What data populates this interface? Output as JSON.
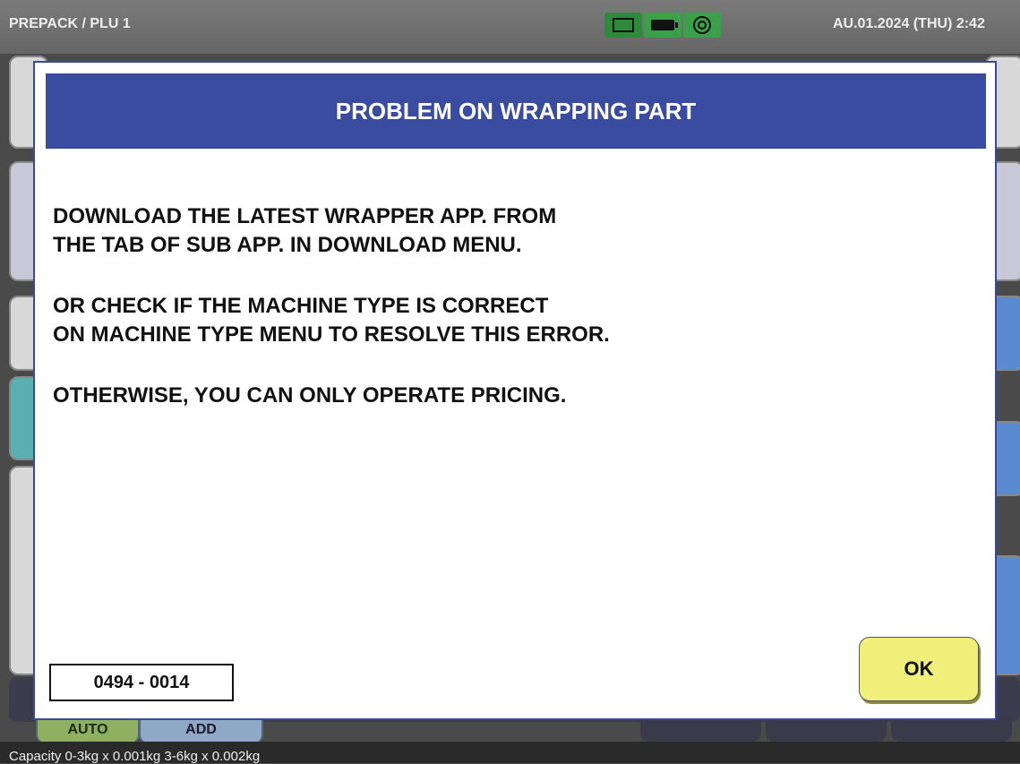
{
  "topbar": {
    "title": "PREPACK / PLU 1",
    "datetime": "AU.01.2024 (THU)  2:42",
    "icons": [
      "screen-icon",
      "battery-icon",
      "spinner-icon"
    ]
  },
  "dialog": {
    "title": "PROBLEM ON WRAPPING PART",
    "lines": [
      "DOWNLOAD THE LATEST WRAPPER APP. FROM",
      "THE TAB OF SUB APP. IN DOWNLOAD MENU.",
      "OR CHECK IF THE MACHINE TYPE IS CORRECT",
      "ON MACHINE TYPE MENU TO RESOLVE THIS ERROR.",
      "OTHERWISE, YOU CAN ONLY OPERATE PRICING."
    ],
    "error_code": "0494 - 0014",
    "ok_label": "OK",
    "colors": {
      "header": "#3a4ca0",
      "ok_button": "#efef7a"
    }
  },
  "bottom": {
    "auto_label": "AUTO",
    "add_label": "ADD",
    "capacity": "Capacity 0-3kg x 0.001kg  3-6kg x 0.002kg"
  }
}
